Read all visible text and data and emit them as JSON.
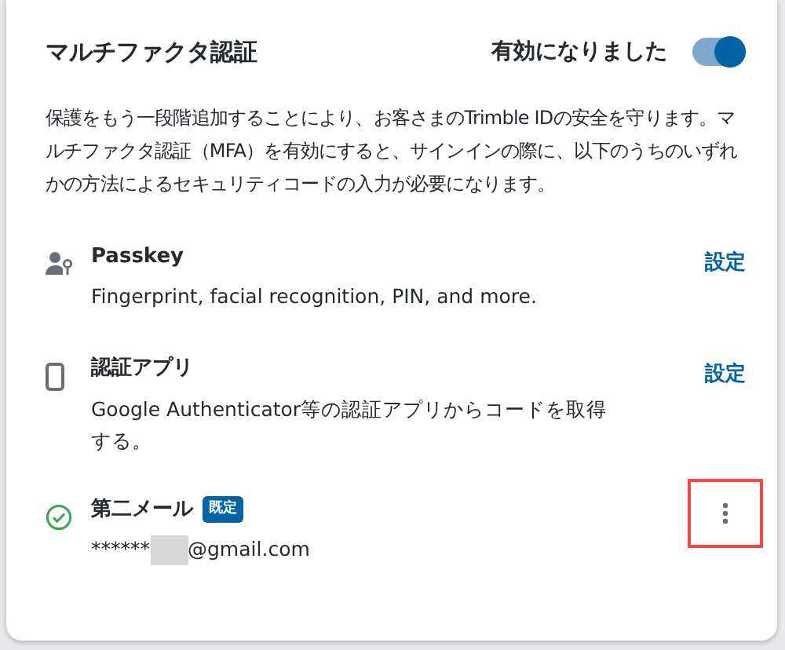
{
  "section": {
    "title": "マルチファクタ認証",
    "status": "有効になりました",
    "enabled": true
  },
  "description": "保護をもう一段階追加することにより、お客さまのTrimble IDの安全を守ります。マルチファクタ認証（MFA）を有効にすると、サインインの際に、以下のうちのいずれかの方法によるセキュリティコードの入力が必要になります。",
  "methods": [
    {
      "kind": "passkey",
      "title": "Passkey",
      "description": "Fingerprint, facial recognition, PIN, and more.",
      "action": "設定"
    },
    {
      "kind": "app",
      "title": "認証アプリ",
      "description": "Google Authenticator等の認証アプリからコードを取得する。",
      "action": "設定"
    },
    {
      "kind": "email",
      "title": "第二メール",
      "badge": "既定",
      "email_masked": "******",
      "email_domain": "@gmail.com",
      "highlighted": true
    }
  ]
}
